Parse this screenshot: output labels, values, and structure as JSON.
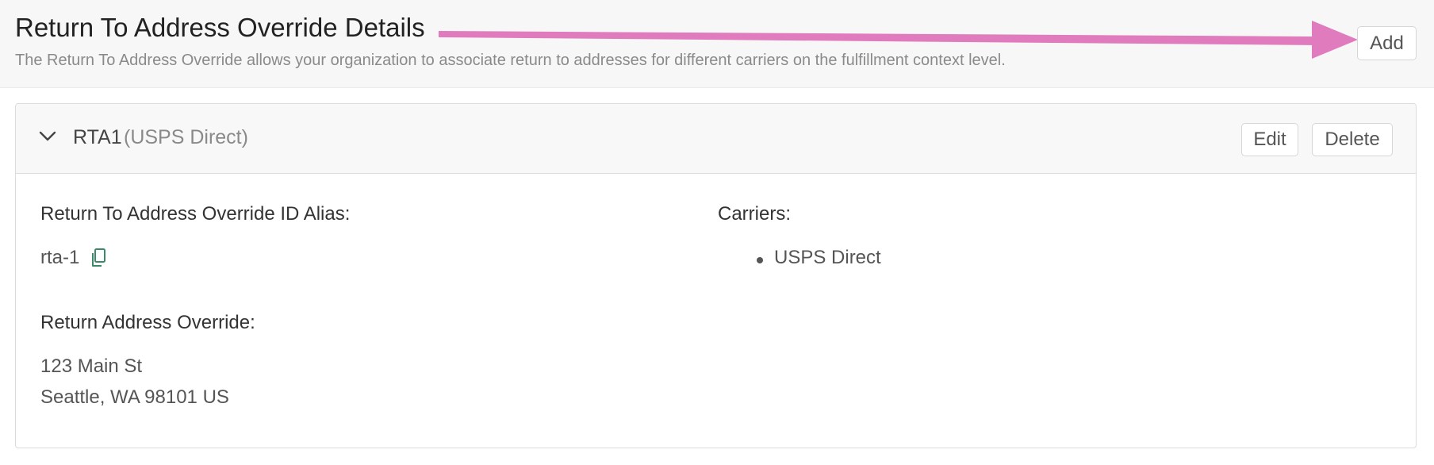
{
  "header": {
    "title": "Return To Address Override Details",
    "description": "The Return To Address Override allows your organization to associate return to addresses for different carriers on the fulfillment context level.",
    "add_label": "Add"
  },
  "card": {
    "name": "RTA1",
    "carrier_label": "(USPS Direct)",
    "edit_label": "Edit",
    "delete_label": "Delete",
    "id_alias_label": "Return To Address Override ID Alias:",
    "id_alias_value": "rta-1",
    "carriers_label": "Carriers:",
    "carriers": [
      "USPS Direct"
    ],
    "return_address_label": "Return Address Override:",
    "address_line1": "123 Main St",
    "address_line2": "Seattle, WA 98101 US"
  },
  "icons": {
    "expand": "chevron-down-icon",
    "copy": "copy-icon"
  },
  "colors": {
    "arrow": "#e07bbd",
    "copy_icon": "#3a8a6a",
    "header_bg": "#f7f7f7"
  }
}
